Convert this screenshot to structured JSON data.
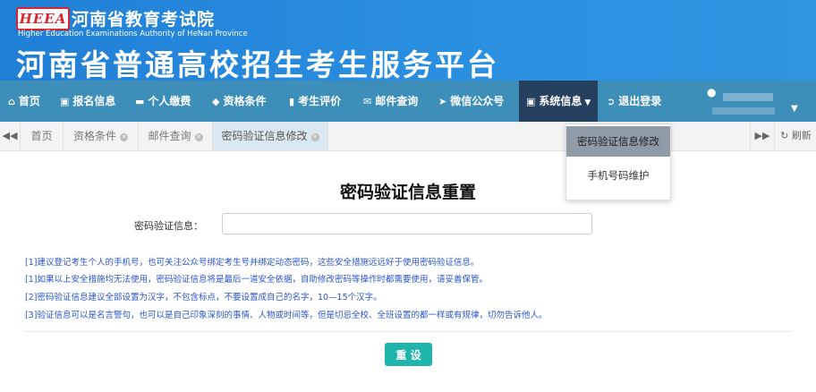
{
  "header": {
    "logo": "HEEA",
    "org_cn": "河南省教育考试院",
    "org_en": "Higher Education Examinations Authority of HeNan Province",
    "platform_title": "河南省普通高校招生考生服务平台"
  },
  "nav": {
    "items": [
      {
        "icon": "home-icon",
        "label": "首页"
      },
      {
        "icon": "id-card-icon",
        "label": "报名信息"
      },
      {
        "icon": "credit-card-icon",
        "label": "个人缴费"
      },
      {
        "icon": "tag-icon",
        "label": "资格条件"
      },
      {
        "icon": "book-icon",
        "label": "考生评价"
      },
      {
        "icon": "envelope-icon",
        "label": "邮件查询"
      },
      {
        "icon": "send-icon",
        "label": "微信公众号"
      },
      {
        "icon": "info-card-icon",
        "label": "系统信息"
      },
      {
        "icon": "logout-icon",
        "label": "退出登录"
      }
    ]
  },
  "tabs": {
    "items": [
      "首页",
      "资格条件",
      "邮件查询",
      "密码验证信息修改"
    ],
    "refresh_label": "刷新"
  },
  "dropdown": {
    "items": [
      "密码验证信息修改",
      "手机号码维护"
    ]
  },
  "form": {
    "title": "密码验证信息重置",
    "field_label": "密码验证信息：",
    "field_value": "",
    "notes": [
      "[1]建议登记考生个人的手机号，也可关注公众号绑定考生号并绑定动态密码，这些安全措施远远好于使用密码验证信息。",
      "[1]如果以上安全措施均无法使用，密码验证信息将是最后一道安全依据，自助修改密码等操作时都需要使用，请妥善保管。",
      "[2]密码验证信息建议全部设置为汉字，不包含标点，不要设置成自己的名字，10—15个汉字。",
      "[3]验证信息可以是名言警句，也可以是自己印象深刻的事情、人物或时间等，但是切忌全校、全班设置的都一样或有规律，切勿告诉他人。"
    ],
    "reset_label": "重 设"
  },
  "colors": {
    "header_blue": "#2b8fe0",
    "nav_bg": "#3d8fba",
    "nav_active": "#26415f",
    "note_text": "#2a55c9",
    "reset_button": "#1fb5ad"
  }
}
